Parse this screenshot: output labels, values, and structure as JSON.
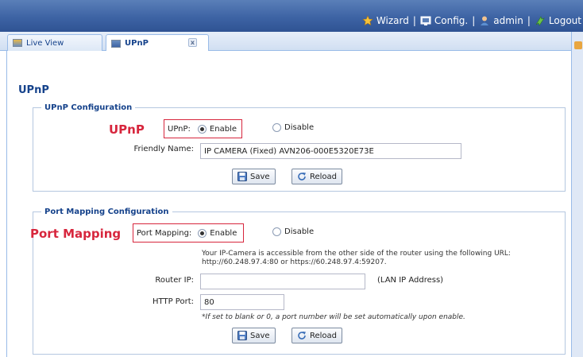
{
  "header": {
    "nav": [
      {
        "label": "Wizard",
        "icon": "wizard-icon"
      },
      {
        "label": "Config.",
        "icon": "config-icon"
      },
      {
        "label": "admin",
        "icon": "user-icon"
      },
      {
        "label": "Logout",
        "icon": "logout-icon"
      }
    ],
    "separator": "|"
  },
  "tabs": [
    {
      "label": "Live View",
      "icon": "live-view-icon"
    },
    {
      "label": "UPnP",
      "icon": "upnp-icon",
      "close": "x"
    }
  ],
  "main": {
    "title": "UPnP",
    "upnp_config": {
      "legend": "UPnP Configuration",
      "callout": "UPnP",
      "upnp_label": "UPnP:",
      "enable_label": "Enable",
      "disable_label": "Disable",
      "selected": "Enable",
      "friendly_name_label": "Friendly Name:",
      "friendly_name_value": "IP CAMERA (Fixed) AVN206-000E5320E73E",
      "save_label": "Save",
      "reload_label": "Reload"
    },
    "port_mapping": {
      "legend": "Port Mapping Configuration",
      "callout": "Port Mapping",
      "port_mapping_label": "Port Mapping:",
      "enable_label": "Enable",
      "disable_label": "Disable",
      "selected": "Enable",
      "info_line1": "Your IP-Camera is accessible from the other side of the router using the following URL:",
      "info_line2": "http://60.248.97.4:80 or https://60.248.97.4:59207.",
      "router_ip_label": "Router IP:",
      "router_ip_value": "",
      "router_ip_hint": "(LAN IP Address)",
      "http_port_label": "HTTP Port:",
      "http_port_value": "80",
      "port_note": "*If set to blank or 0, a port number will be set automatically upon enable.",
      "save_label": "Save",
      "reload_label": "Reload"
    }
  },
  "colors": {
    "header_bg": "#3d63a4",
    "accent": "#15428b",
    "callout_red": "#d7263d"
  }
}
